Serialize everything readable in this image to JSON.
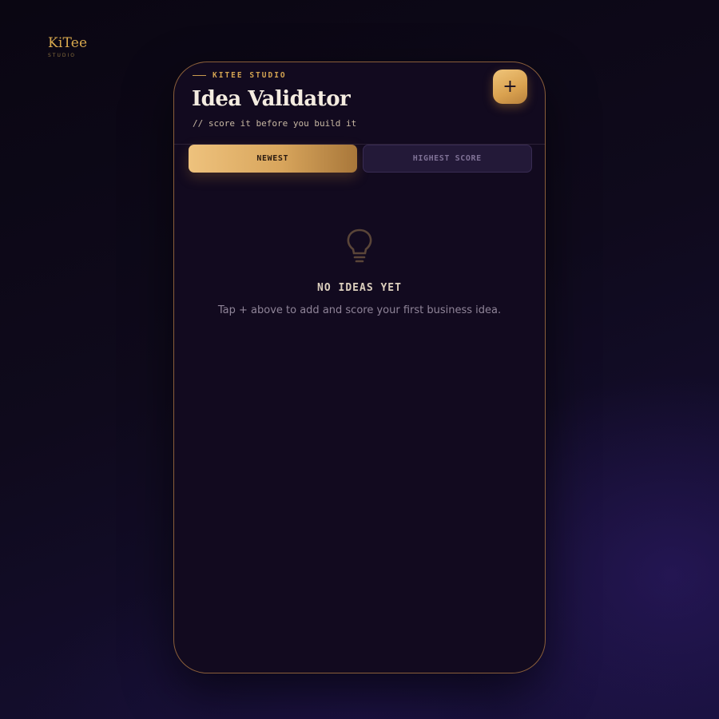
{
  "brand": {
    "name": "KiTee",
    "sub": "STUDIO"
  },
  "header": {
    "kicker": "KITEE STUDIO",
    "title": "Idea Validator",
    "tagline": "// score it before you build it",
    "add_label": "+"
  },
  "tabs": [
    {
      "label": "NEWEST",
      "active": true
    },
    {
      "label": "HIGHEST SCORE",
      "active": false
    }
  ],
  "empty_state": {
    "icon": "lightbulb-icon",
    "title": "NO IDEAS YET",
    "message": "Tap + above to add and score your first business idea."
  },
  "colors": {
    "accent": "#d9a14f",
    "background": "#120a1f",
    "border": "#8a5e3a"
  }
}
